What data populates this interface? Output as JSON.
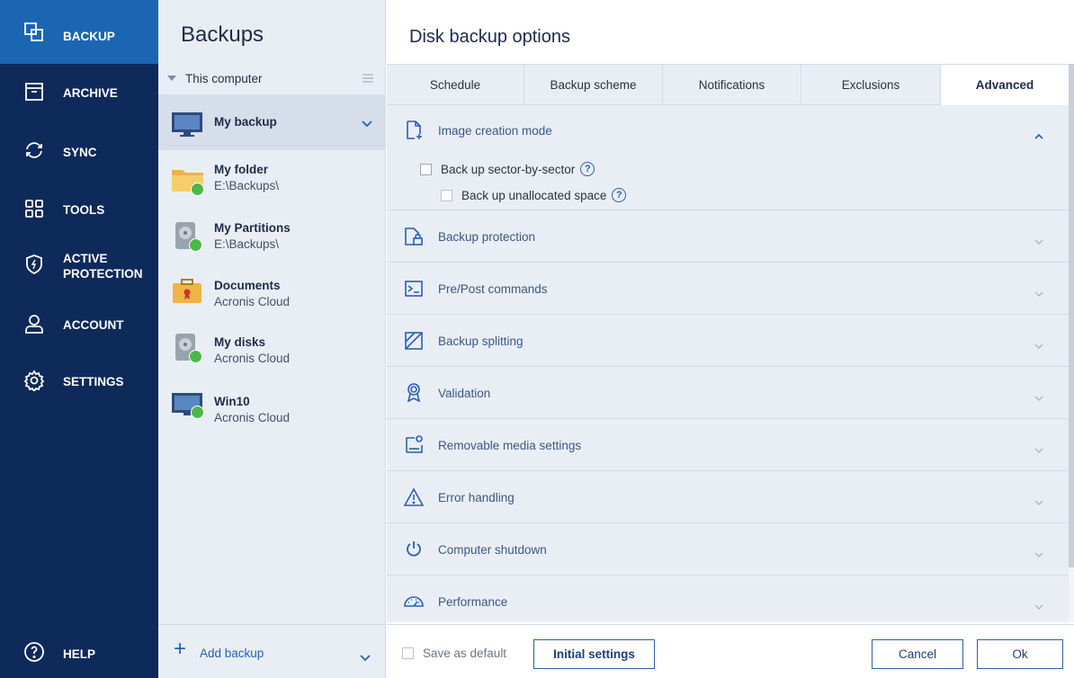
{
  "nav": {
    "items": [
      {
        "label": "BACKUP",
        "icon": "backup-icon"
      },
      {
        "label": "ARCHIVE",
        "icon": "archive-icon"
      },
      {
        "label": "SYNC",
        "icon": "sync-icon"
      },
      {
        "label": "TOOLS",
        "icon": "tools-icon"
      },
      {
        "label_line1": "ACTIVE",
        "label_line2": "PROTECTION",
        "icon": "shield-icon"
      },
      {
        "label": "ACCOUNT",
        "icon": "account-icon"
      },
      {
        "label": "SETTINGS",
        "icon": "gear-icon"
      }
    ],
    "help": {
      "label": "HELP",
      "icon": "help-icon"
    }
  },
  "list": {
    "title": "Backups",
    "group": "This computer",
    "items": [
      {
        "name": "My backup",
        "sub": ""
      },
      {
        "name": "My folder",
        "sub": "E:\\Backups\\"
      },
      {
        "name": "My Partitions",
        "sub": "E:\\Backups\\"
      },
      {
        "name": "Documents",
        "sub": "Acronis Cloud"
      },
      {
        "name": "My disks",
        "sub": "Acronis Cloud"
      },
      {
        "name": "Win10",
        "sub": "Acronis Cloud"
      }
    ],
    "add_label": "Add backup"
  },
  "main": {
    "title": "Disk backup options",
    "tabs": [
      "Schedule",
      "Backup scheme",
      "Notifications",
      "Exclusions",
      "Advanced"
    ],
    "active_tab": "Advanced",
    "sections": [
      {
        "title": "Image creation mode",
        "icon": "image-file-icon",
        "expanded": true
      },
      {
        "title": "Backup protection",
        "icon": "lock-file-icon"
      },
      {
        "title": "Pre/Post commands",
        "icon": "terminal-icon"
      },
      {
        "title": "Backup splitting",
        "icon": "split-icon"
      },
      {
        "title": "Validation",
        "icon": "badge-icon"
      },
      {
        "title": "Removable media settings",
        "icon": "removable-media-icon"
      },
      {
        "title": "Error handling",
        "icon": "warning-icon"
      },
      {
        "title": "Computer shutdown",
        "icon": "power-icon"
      },
      {
        "title": "Performance",
        "icon": "speedometer-icon"
      }
    ],
    "options": {
      "sector_by_sector": "Back up sector-by-sector",
      "unallocated": "Back up unallocated space",
      "help_glyph": "?"
    }
  },
  "footer": {
    "save_default": "Save as default",
    "initial_settings": "Initial settings",
    "cancel": "Cancel",
    "ok": "Ok"
  },
  "colors": {
    "nav_bg": "#0e2a5a",
    "nav_active": "#1a66b2",
    "panel_bg": "#e9eef5",
    "accent": "#2a5fb0",
    "success": "#4cb84a"
  }
}
